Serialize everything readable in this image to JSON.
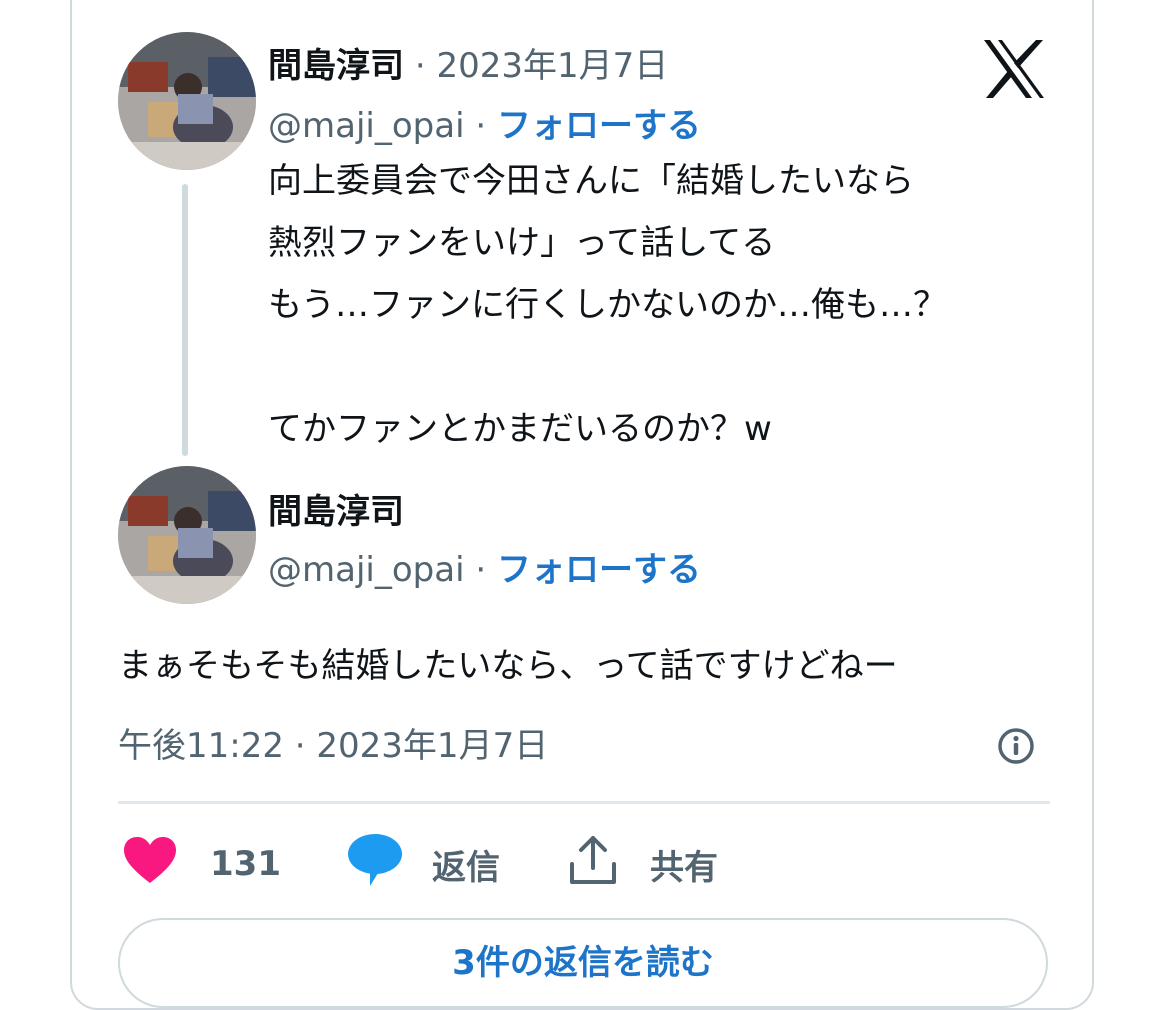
{
  "tweet": {
    "author_name": "間島淳司",
    "separator": "·",
    "date": "2023年1月7日",
    "handle": "@maji_opai",
    "follow_label": "フォローする",
    "text": "向上委員会で今田さんに「結婚したいなら\n熱烈ファンをいけ」って話してる\nもう…ファンに行くしかないのか…俺も…？\n\nてかファンとかまだいるのか？w"
  },
  "reply": {
    "author_name": "間島淳司",
    "handle": "@maji_opai",
    "separator": "·",
    "follow_label": "フォローする",
    "text": "まぁそもそも結婚したいなら、って話ですけどねー",
    "timestamp": "午後11:22 · 2023年1月7日"
  },
  "actions": {
    "like_count": "131",
    "reply_label": "返信",
    "share_label": "共有"
  },
  "bottom_button_label": "3件の返信を読む",
  "icons": {
    "logo": "x-logo-icon",
    "info": "info-icon",
    "like": "heart-icon",
    "reply": "speech-bubble-icon",
    "share": "share-upload-icon"
  },
  "colors": {
    "follow": "#1d74c9",
    "heart": "#f91880",
    "reply_icon": "#1d9bf0",
    "muted": "#536471"
  }
}
